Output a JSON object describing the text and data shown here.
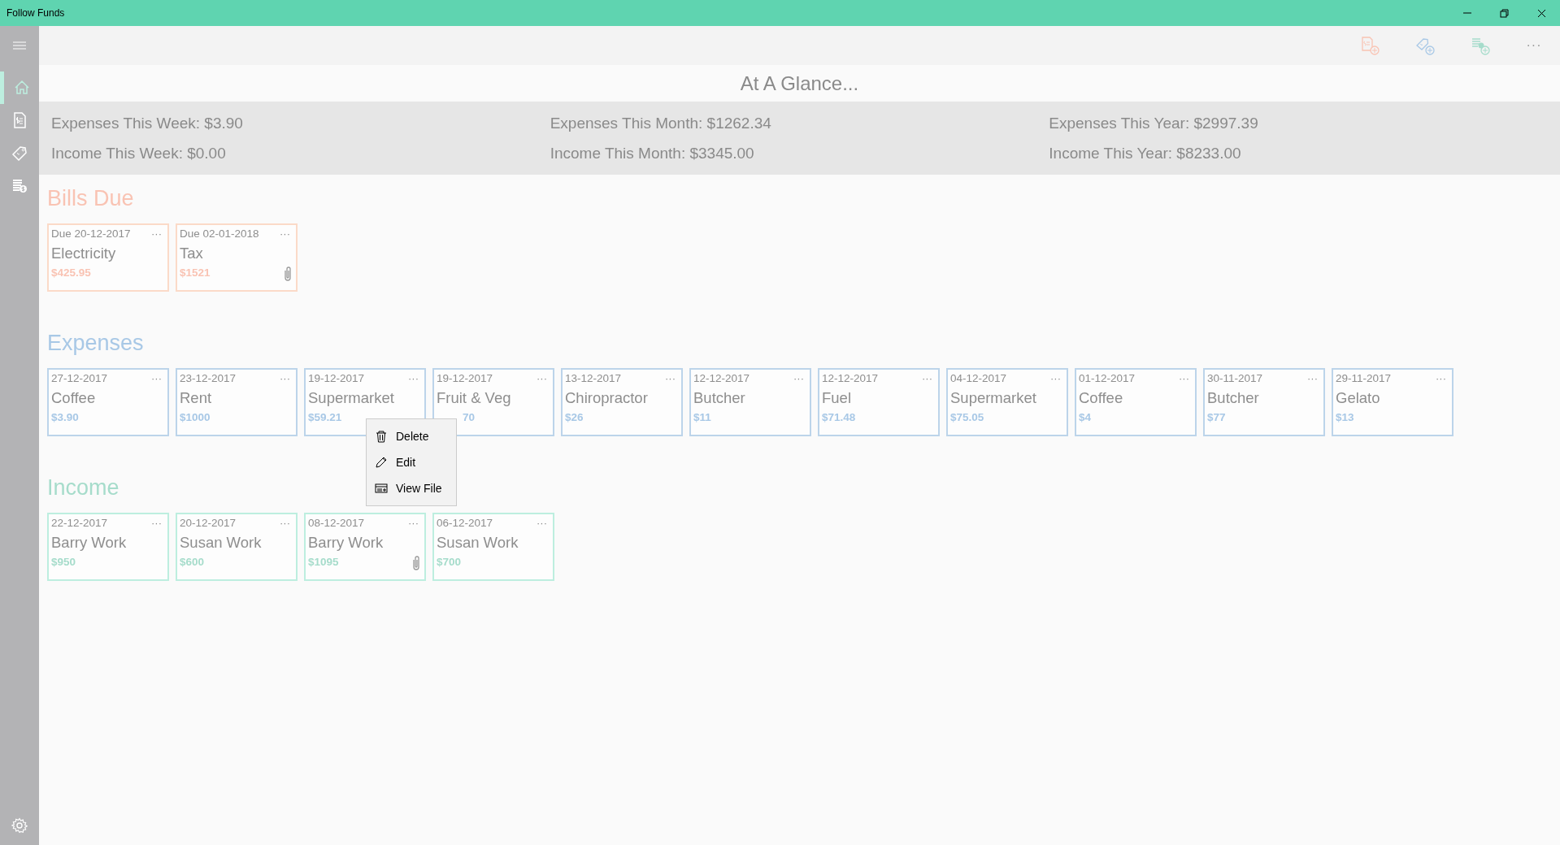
{
  "window": {
    "title": "Follow Funds"
  },
  "sidebar": {
    "items": [
      {
        "kind": "home",
        "selected": true
      },
      {
        "kind": "bill",
        "selected": false
      },
      {
        "kind": "tag",
        "selected": false
      },
      {
        "kind": "coins",
        "selected": false
      }
    ]
  },
  "toolbar": {
    "more": "···"
  },
  "heading": "At A Glance...",
  "summary": [
    [
      "Expenses This Week: $3.90",
      "Income This Week: $0.00"
    ],
    [
      "Expenses This Month: $1262.34",
      "Income This Month: $3345.00"
    ],
    [
      "Expenses This Year: $2997.39",
      "Income This Year: $8233.00"
    ]
  ],
  "sections": [
    {
      "kind": "bills",
      "title": "Bills Due",
      "color": "#f9c3b3",
      "items": [
        {
          "date": "Due 20-12-2017",
          "name": "Electricity",
          "amount": "$425.95",
          "attachment": false
        },
        {
          "date": "Due 02-01-2018",
          "name": "Tax",
          "amount": "$1521",
          "attachment": true
        }
      ]
    },
    {
      "kind": "expenses",
      "title": "Expenses",
      "color": "#a8c8e6",
      "items": [
        {
          "date": "27-12-2017",
          "name": "Coffee",
          "amount": "$3.90",
          "attachment": false
        },
        {
          "date": "23-12-2017",
          "name": "Rent",
          "amount": "$1000",
          "attachment": false
        },
        {
          "date": "19-12-2017",
          "name": "Supermarket",
          "amount": "$59.21",
          "attachment": false,
          "menu_open": true
        },
        {
          "date": "19-12-2017",
          "name": "Fruit & Veg",
          "amount": "70",
          "attachment": false,
          "partly_covered": true
        },
        {
          "date": "13-12-2017",
          "name": "Chiropractor",
          "amount": "$26",
          "attachment": false
        },
        {
          "date": "12-12-2017",
          "name": "Butcher",
          "amount": "$11",
          "attachment": false
        },
        {
          "date": "12-12-2017",
          "name": "Fuel",
          "amount": "$71.48",
          "attachment": false
        },
        {
          "date": "04-12-2017",
          "name": "Supermarket",
          "amount": "$75.05",
          "attachment": false
        },
        {
          "date": "01-12-2017",
          "name": "Coffee",
          "amount": "$4",
          "attachment": false
        },
        {
          "date": "30-11-2017",
          "name": "Butcher",
          "amount": "$77",
          "attachment": false
        },
        {
          "date": "29-11-2017",
          "name": "Gelato",
          "amount": "$13",
          "attachment": false
        }
      ]
    },
    {
      "kind": "income",
      "title": "Income",
      "color": "#a6dccb",
      "items": [
        {
          "date": "22-12-2017",
          "name": "Barry Work",
          "amount": "$950",
          "attachment": false
        },
        {
          "date": "20-12-2017",
          "name": "Susan Work",
          "amount": "$600",
          "attachment": false
        },
        {
          "date": "08-12-2017",
          "name": "Barry Work",
          "amount": "$1095",
          "attachment": true
        },
        {
          "date": "06-12-2017",
          "name": "Susan Work",
          "amount": "$700",
          "attachment": false
        }
      ]
    }
  ],
  "card_more": "···",
  "context_menu": [
    {
      "kind": "delete",
      "label": "Delete"
    },
    {
      "kind": "edit",
      "label": "Edit"
    },
    {
      "kind": "view",
      "label": "View File"
    }
  ]
}
